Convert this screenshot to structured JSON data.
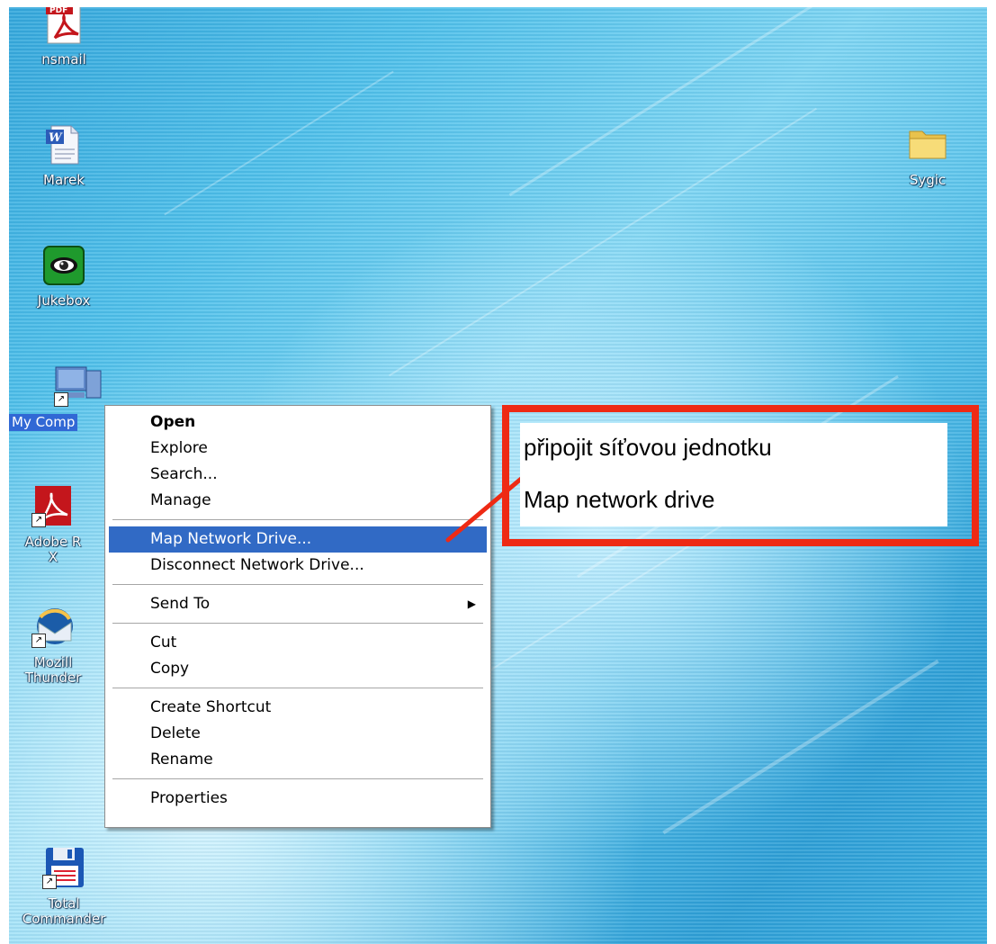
{
  "desktop": {
    "icons": [
      {
        "label": "nsmail",
        "icon": "pdf-icon"
      },
      {
        "label": "Marek",
        "icon": "word-document-icon"
      },
      {
        "label": "Jukebox",
        "icon": "jukebox-eye-icon"
      },
      {
        "label": "My Comp",
        "icon": "my-computer-icon",
        "selected": true
      },
      {
        "label": "Adobe R\nX",
        "icon": "adobe-reader-icon"
      },
      {
        "label": "Mozill\nThunder",
        "icon": "thunderbird-icon"
      },
      {
        "label": "Total\nCommander",
        "icon": "floppy-disk-icon"
      },
      {
        "label": "Sygic",
        "icon": "folder-icon"
      }
    ]
  },
  "context_menu": {
    "items": [
      {
        "label": "Open"
      },
      {
        "label": "Explore"
      },
      {
        "label": "Search..."
      },
      {
        "label": "Manage"
      },
      {
        "label": "Map Network Drive..."
      },
      {
        "label": "Disconnect Network Drive..."
      },
      {
        "label": "Send To"
      },
      {
        "label": "Cut"
      },
      {
        "label": "Copy"
      },
      {
        "label": "Create Shortcut"
      },
      {
        "label": "Delete"
      },
      {
        "label": "Rename"
      },
      {
        "label": "Properties"
      }
    ],
    "submenu_arrow": "▶"
  },
  "annotation": {
    "line1": "připojit síťovou jednotku",
    "line2": "Map network drive",
    "color": "#ee2a14"
  },
  "colors": {
    "highlight": "#316ac5",
    "selection": "#3168d5"
  }
}
